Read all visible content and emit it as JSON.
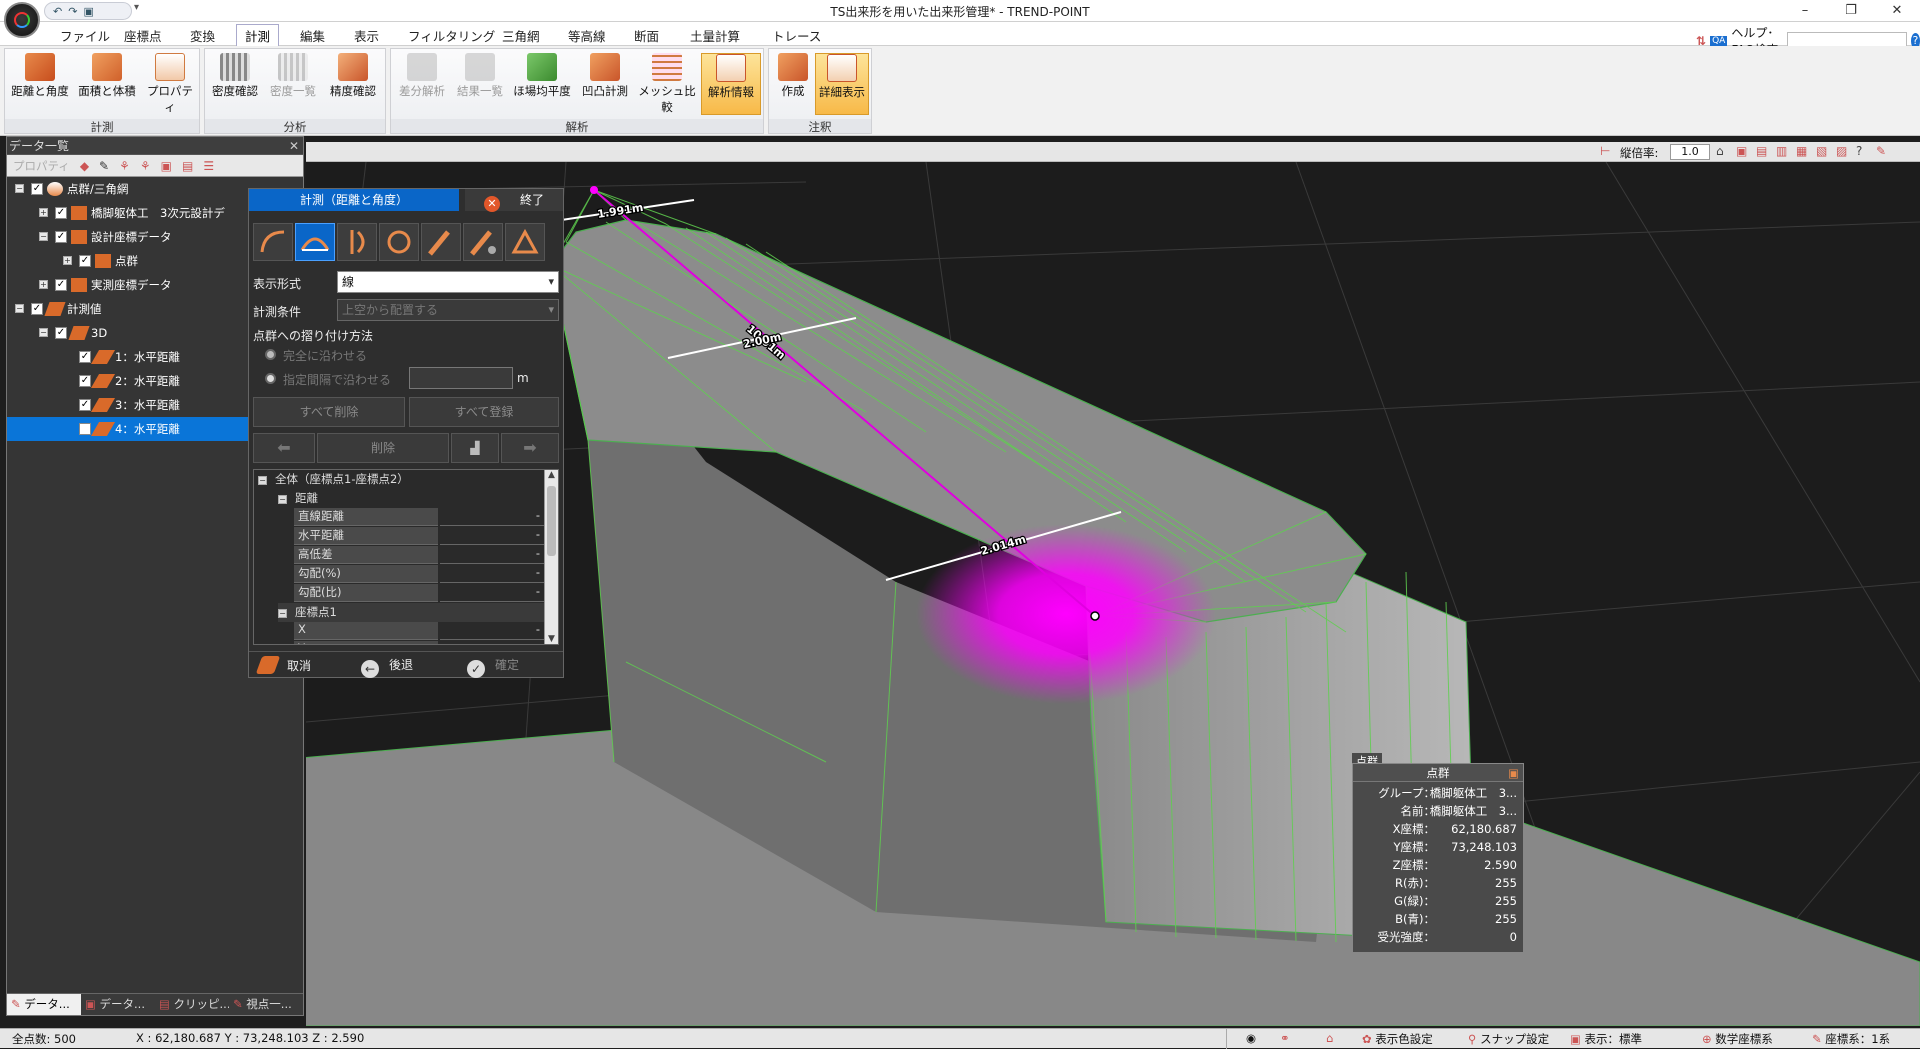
{
  "window": {
    "title": "TS出来形を用いた出来形管理* - TREND-POINT"
  },
  "menu": [
    "ファイル",
    "座標点",
    "変換",
    "計測",
    "編集",
    "表示",
    "フィルタリング",
    "三角網",
    "等高線",
    "断面",
    "土量計算",
    "トレース"
  ],
  "help": {
    "label": "ヘルプ･FAQ検索",
    "value": ""
  },
  "ribbon": {
    "groups": [
      {
        "label": "計測",
        "buttons": [
          "距離と角度",
          "面積と体積",
          "プロパティ"
        ]
      },
      {
        "label": "分析",
        "buttons": [
          "密度確認",
          "密度一覧",
          "精度確認"
        ]
      },
      {
        "label": "解析",
        "buttons": [
          "差分解析",
          "結果一覧",
          "ほ場均平度",
          "凹凸計測",
          "メッシュ比較",
          "解析情報"
        ]
      },
      {
        "label": "注釈",
        "buttons": [
          "作成",
          "詳細表示"
        ]
      }
    ]
  },
  "left_panel": {
    "title": "データ一覧",
    "tools_label": "プロパティ",
    "tree": [
      {
        "label": "点群/三角網",
        "level": 0
      },
      {
        "label": "橋脚躯体工　3次元設計デ",
        "level": 1
      },
      {
        "label": "設計座標データ",
        "level": 1
      },
      {
        "label": "点群",
        "level": 2
      },
      {
        "label": "実測座標データ",
        "level": 1
      },
      {
        "label": "計測値",
        "level": 0
      },
      {
        "label": "3D",
        "level": 1
      },
      {
        "label": "1：水平距離",
        "level": 2
      },
      {
        "label": "2：水平距離",
        "level": 2
      },
      {
        "label": "3：水平距離",
        "level": 2
      },
      {
        "label": "4：水平距離",
        "level": 2
      }
    ],
    "tabs": [
      "データ...",
      "データ...",
      "クリッピ...",
      "視点一..."
    ]
  },
  "view_toolbar": {
    "zoom_label": "縦倍率:",
    "zoom_value": "1.0"
  },
  "measure_panel": {
    "title": "計測（距離と角度）",
    "close_label": "終了",
    "display_format_label": "表示形式",
    "display_format_value": "線",
    "condition_label": "計測条件",
    "condition_value": "上空から配置する",
    "snap_label": "点群への摺り付け方法",
    "radio1": "完全に沿わせる",
    "radio2": "指定間隔で沿わせる",
    "interval_unit": "m",
    "delete_all": "すべて削除",
    "register_all": "すべて登録",
    "delete": "削除",
    "grid": {
      "root": "全体（座標点1-座標点2）",
      "section1": "距離",
      "rows": [
        {
          "name": "直線距離",
          "value": "-"
        },
        {
          "name": "水平距離",
          "value": "-"
        },
        {
          "name": "高低差",
          "value": "-"
        },
        {
          "name": "勾配(%)",
          "value": "-"
        },
        {
          "name": "勾配(比)",
          "value": "-"
        }
      ],
      "section2": "座標点1",
      "rows2": [
        {
          "name": "X",
          "value": "-"
        },
        {
          "name": "Y",
          "value": ""
        }
      ]
    },
    "footer": {
      "cancel": "取消",
      "back": "後退",
      "confirm": "確定"
    }
  },
  "viewport": {
    "dimensions": [
      "1.991m",
      "10.01m",
      "2.00m",
      "2.014m"
    ]
  },
  "point_info": {
    "tag": "点群",
    "title": "点群",
    "rows": [
      {
        "k": "グループ：",
        "v": "橋脚躯体工　3..."
      },
      {
        "k": "名前：",
        "v": "橋脚躯体工　3..."
      },
      {
        "k": "X座標：",
        "v": "62,180.687"
      },
      {
        "k": "Y座標：",
        "v": "73,248.103"
      },
      {
        "k": "Z座標：",
        "v": "2.590"
      },
      {
        "k": "R(赤)：",
        "v": "255"
      },
      {
        "k": "G(緑)：",
        "v": "255"
      },
      {
        "k": "B(青)：",
        "v": "255"
      },
      {
        "k": "受光強度：",
        "v": "0"
      }
    ]
  },
  "status": {
    "points": "全点数: 500",
    "coords": "X : 62,180.687  Y : 73,248.103  Z : 2.590",
    "color_setting": "表示色設定",
    "snap_setting": "スナップ設定",
    "display": "表示：標準",
    "math_coord": "数学座標系",
    "coord_system": "座標系：1系"
  },
  "colors": {
    "accent": "#0a66c8",
    "highlight": "#ff00ff",
    "wire": "#3fbf3f"
  }
}
